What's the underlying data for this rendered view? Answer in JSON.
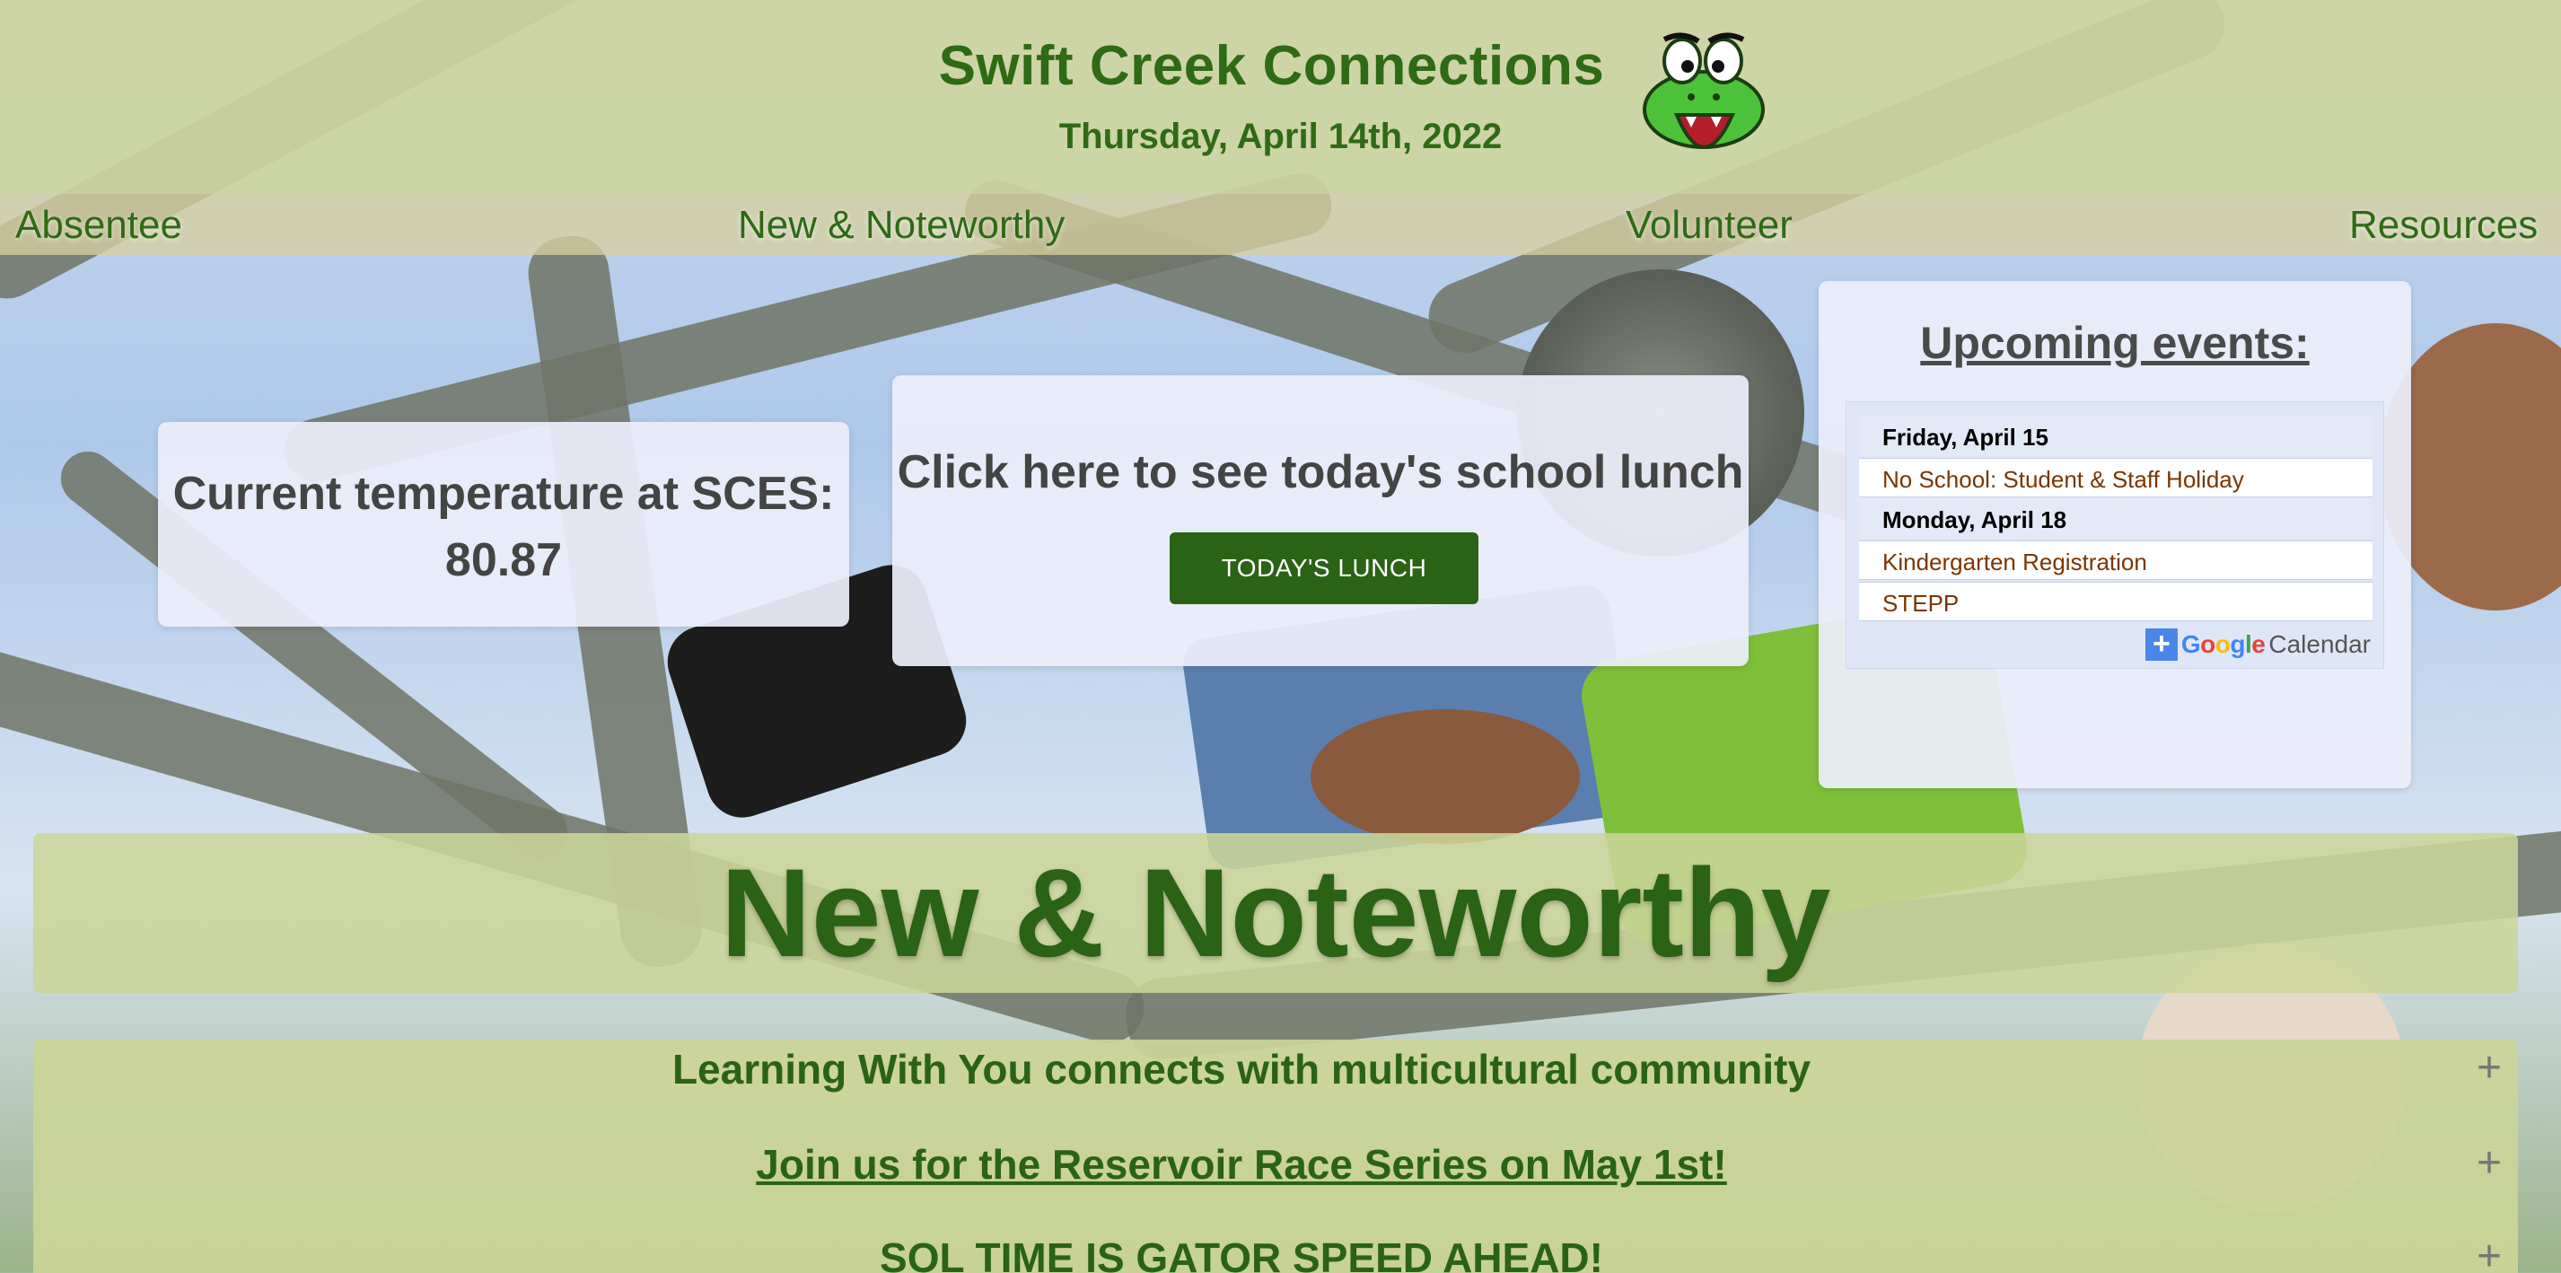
{
  "header": {
    "title": "Swift Creek Connections",
    "date": "Thursday, April 14th, 2022",
    "logo_icon": "gator-mascot-icon"
  },
  "nav": {
    "items": [
      {
        "label": "Absentee"
      },
      {
        "label": "New & Noteworthy"
      },
      {
        "label": "Volunteer"
      },
      {
        "label": "Resources"
      }
    ]
  },
  "temperature": {
    "label": "Current temperature at SCES:",
    "value": "80.87"
  },
  "lunch": {
    "prompt": "Click here to see today's school lunch",
    "button_label": "TODAY'S LUNCH"
  },
  "events": {
    "title": "Upcoming events:",
    "rows": [
      {
        "type": "date",
        "text": "Friday, April 15"
      },
      {
        "type": "event",
        "text": "No School: Student & Staff Holiday"
      },
      {
        "type": "date",
        "text": "Monday, April 18"
      },
      {
        "type": "event",
        "text": "Kindergarten Registration"
      },
      {
        "type": "event",
        "text": "STEPP"
      }
    ],
    "calendar_badge": {
      "plus": "+",
      "google": "Google",
      "calendar": "Calendar"
    }
  },
  "noteworthy": {
    "title": "New & Noteworthy",
    "items": [
      {
        "label": "Learning With You connects with multicultural community",
        "toggle": "+"
      },
      {
        "label": "Join us for the Reservoir Race Series on May 1st!",
        "toggle": "+"
      },
      {
        "label": "SOL TIME IS GATOR SPEED AHEAD!",
        "toggle": "+"
      }
    ]
  },
  "colors": {
    "brand_green": "#2f6a16",
    "button_green": "#2a6316",
    "event_text": "#7a3500",
    "google_blue": "#4a86e8"
  }
}
